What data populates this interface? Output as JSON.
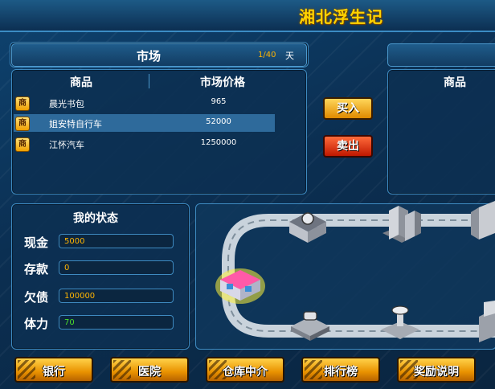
{
  "game_title": "湘北浮生记",
  "market": {
    "title": "市场",
    "day_current": "1/40",
    "day_unit": "天",
    "col_goods": "商品",
    "col_price": "市场价格",
    "items": [
      {
        "badge": "商",
        "name": "晨光书包",
        "price": "965"
      },
      {
        "badge": "商",
        "name": "姐安特自行车",
        "price": "52000"
      },
      {
        "badge": "商",
        "name": "江怀汽车",
        "price": "1250000"
      }
    ]
  },
  "actions": {
    "buy": "买入",
    "sell": "卖出"
  },
  "inventory": {
    "col_goods": "商品"
  },
  "status": {
    "title": "我的状态",
    "cash_label": "现金",
    "cash": "5000",
    "deposit_label": "存款",
    "deposit": "0",
    "debt_label": "欠债",
    "debt": "100000",
    "stamina_label": "体力",
    "stamina": "70"
  },
  "bottom_buttons": [
    "银行",
    "医院",
    "仓库中介",
    "排行榜",
    "奖励说明"
  ],
  "colors": {
    "accent_gold": "#ffd200",
    "cash_text": "#ffb400",
    "stamina_text": "#4cdc2a",
    "panel_border": "#3e8ac0"
  }
}
